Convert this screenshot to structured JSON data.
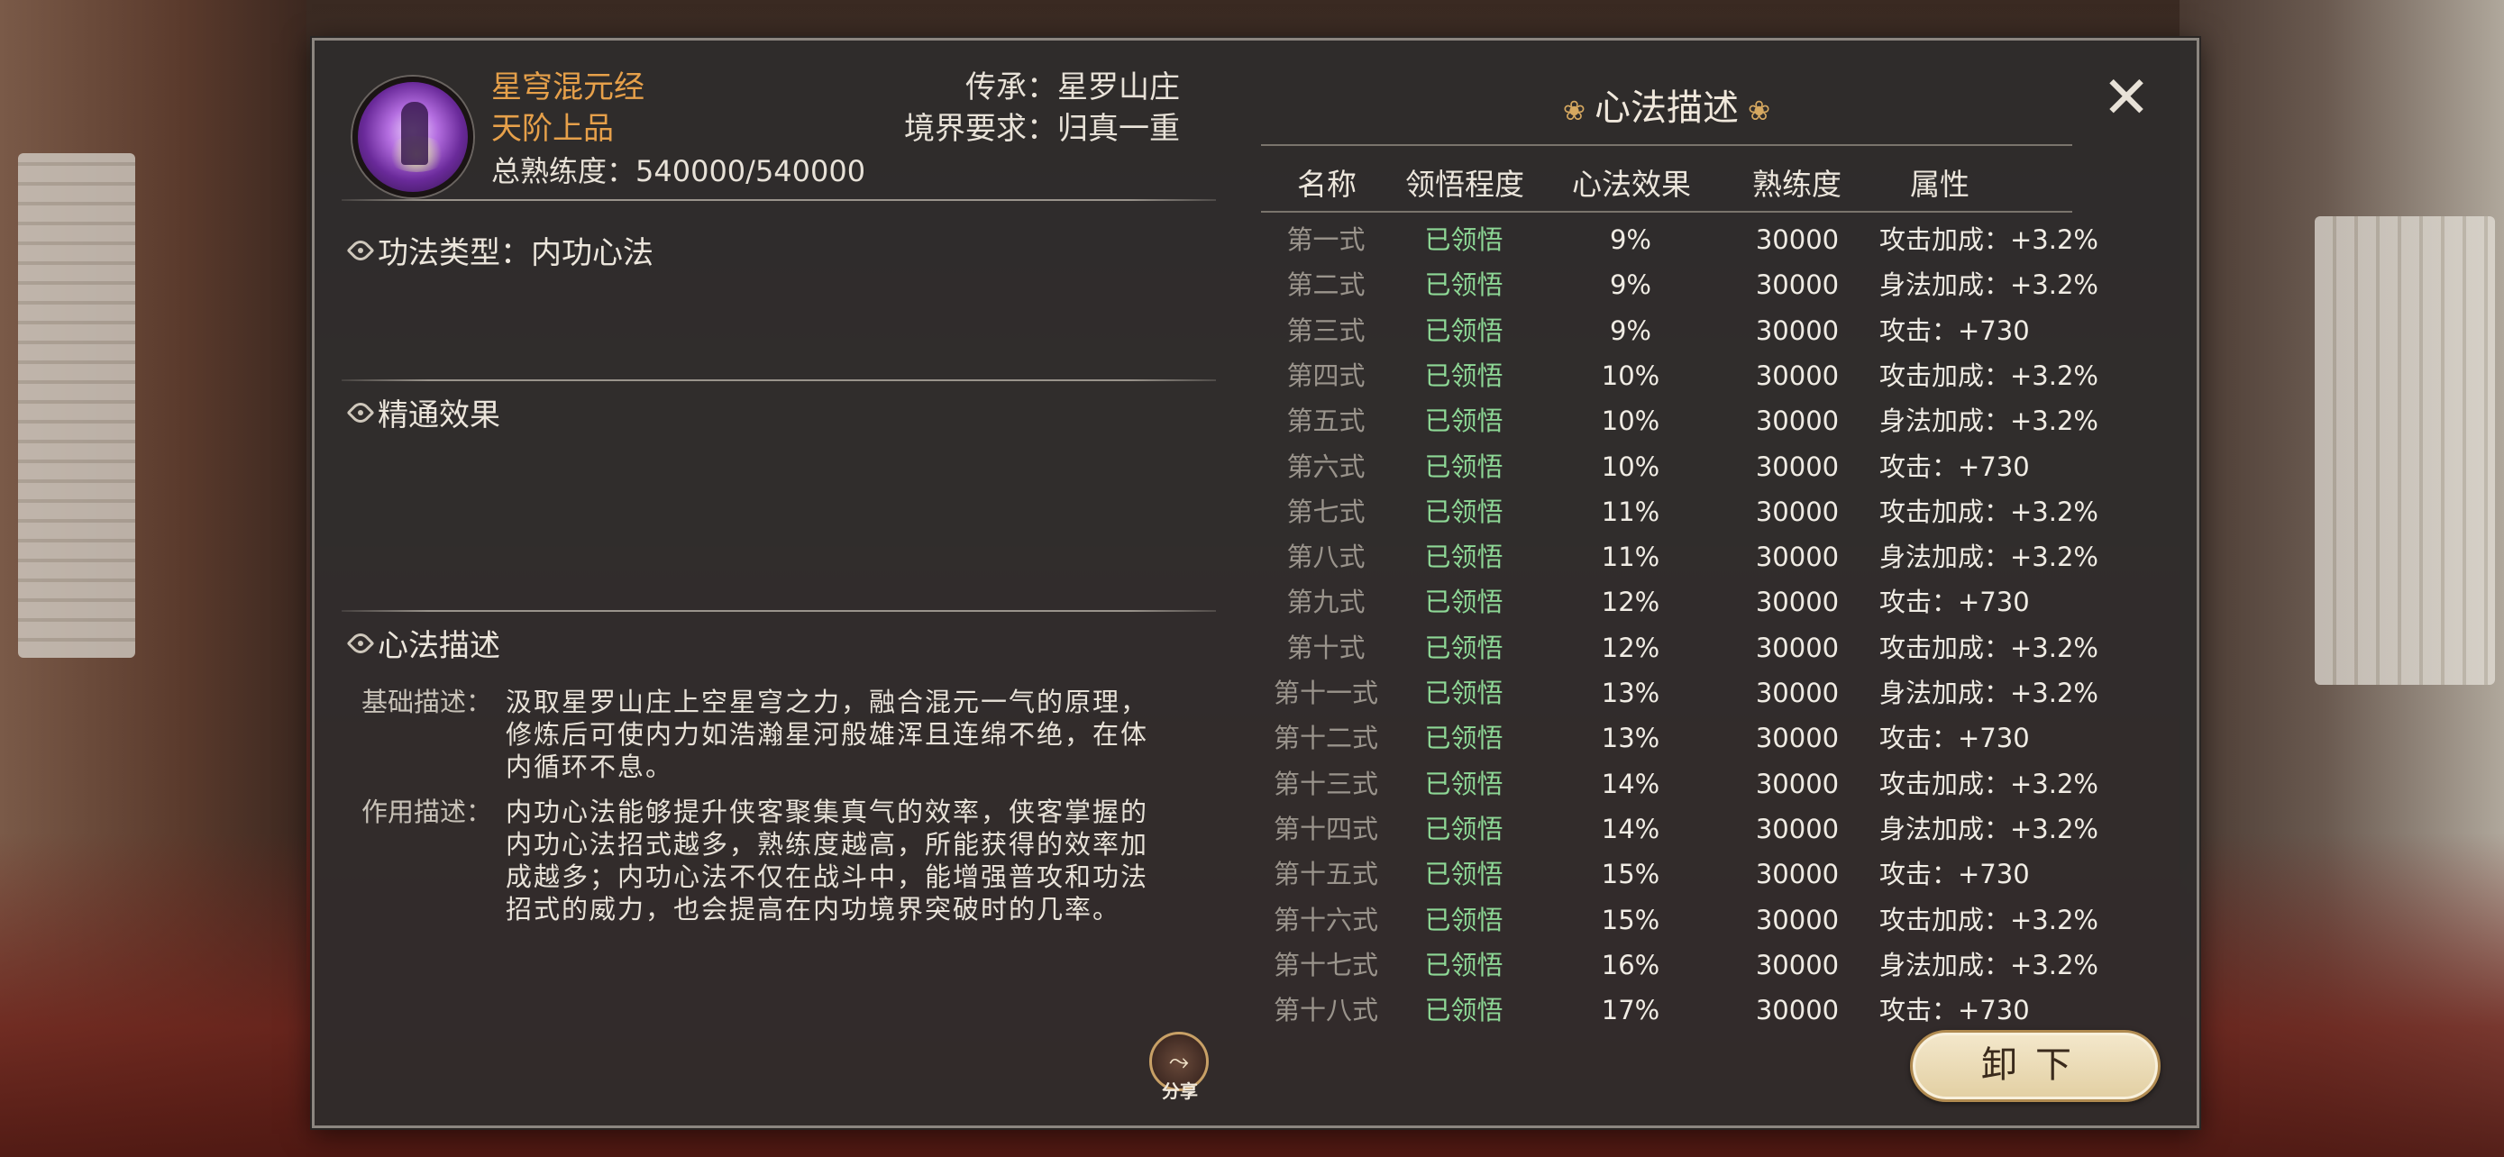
{
  "skill": {
    "name": "星穹混元经",
    "grade": "天阶上品",
    "total_proficiency": "总熟练度：540000/540000",
    "inheritance": "传承：星罗山庄",
    "realm_requirement": "境界要求：归真一重"
  },
  "sections": {
    "type_line": "功法类型：内功心法",
    "mastery_title": "精通效果",
    "desc_title": "心法描述"
  },
  "description": {
    "basic_label": "基础描述：",
    "basic_text": "汲取星罗山庄上空星穹之力，融合混元一气的原理，修炼后可使内力如浩瀚星河般雄浑且连绵不绝，在体内循环不息。",
    "usage_label": "作用描述：",
    "usage_text": "内功心法能够提升侠客聚集真气的效率，侠客掌握的内功心法招式越多，熟练度越高，所能获得的效率加成越多；内功心法不仅在战斗中，能增强普攻和功法招式的威力，也会提高在内功境界突破时的几率。"
  },
  "share": {
    "label": "分享"
  },
  "right_panel": {
    "title": "心法描述",
    "headers": [
      "名称",
      "领悟程度",
      "心法效果",
      "熟练度",
      "属性"
    ],
    "rows": [
      {
        "name": "第一式",
        "state": "已领悟",
        "effect": "9%",
        "proficiency": "30000",
        "attr": "攻击加成：+3.2%"
      },
      {
        "name": "第二式",
        "state": "已领悟",
        "effect": "9%",
        "proficiency": "30000",
        "attr": "身法加成：+3.2%"
      },
      {
        "name": "第三式",
        "state": "已领悟",
        "effect": "9%",
        "proficiency": "30000",
        "attr": "攻击：+730"
      },
      {
        "name": "第四式",
        "state": "已领悟",
        "effect": "10%",
        "proficiency": "30000",
        "attr": "攻击加成：+3.2%"
      },
      {
        "name": "第五式",
        "state": "已领悟",
        "effect": "10%",
        "proficiency": "30000",
        "attr": "身法加成：+3.2%"
      },
      {
        "name": "第六式",
        "state": "已领悟",
        "effect": "10%",
        "proficiency": "30000",
        "attr": "攻击：+730"
      },
      {
        "name": "第七式",
        "state": "已领悟",
        "effect": "11%",
        "proficiency": "30000",
        "attr": "攻击加成：+3.2%"
      },
      {
        "name": "第八式",
        "state": "已领悟",
        "effect": "11%",
        "proficiency": "30000",
        "attr": "身法加成：+3.2%"
      },
      {
        "name": "第九式",
        "state": "已领悟",
        "effect": "12%",
        "proficiency": "30000",
        "attr": "攻击：+730"
      },
      {
        "name": "第十式",
        "state": "已领悟",
        "effect": "12%",
        "proficiency": "30000",
        "attr": "攻击加成：+3.2%"
      },
      {
        "name": "第十一式",
        "state": "已领悟",
        "effect": "13%",
        "proficiency": "30000",
        "attr": "身法加成：+3.2%"
      },
      {
        "name": "第十二式",
        "state": "已领悟",
        "effect": "13%",
        "proficiency": "30000",
        "attr": "攻击：+730"
      },
      {
        "name": "第十三式",
        "state": "已领悟",
        "effect": "14%",
        "proficiency": "30000",
        "attr": "攻击加成：+3.2%"
      },
      {
        "name": "第十四式",
        "state": "已领悟",
        "effect": "14%",
        "proficiency": "30000",
        "attr": "身法加成：+3.2%"
      },
      {
        "name": "第十五式",
        "state": "已领悟",
        "effect": "15%",
        "proficiency": "30000",
        "attr": "攻击：+730"
      },
      {
        "name": "第十六式",
        "state": "已领悟",
        "effect": "15%",
        "proficiency": "30000",
        "attr": "攻击加成：+3.2%"
      },
      {
        "name": "第十七式",
        "state": "已领悟",
        "effect": "16%",
        "proficiency": "30000",
        "attr": "身法加成：+3.2%"
      },
      {
        "name": "第十八式",
        "state": "已领悟",
        "effect": "17%",
        "proficiency": "30000",
        "attr": "攻击：+730"
      }
    ],
    "unload_label": "卸下"
  },
  "icons": {
    "close": "close-icon",
    "share": "share-icon",
    "section_mark": "section-mark-icon",
    "cloud": "cloud-ornament-icon",
    "avatar": "skill-avatar"
  },
  "colors": {
    "title_gold": "#e6a04a",
    "learned_green": "#8ed896",
    "panel_bg": "#2e2c2c"
  }
}
